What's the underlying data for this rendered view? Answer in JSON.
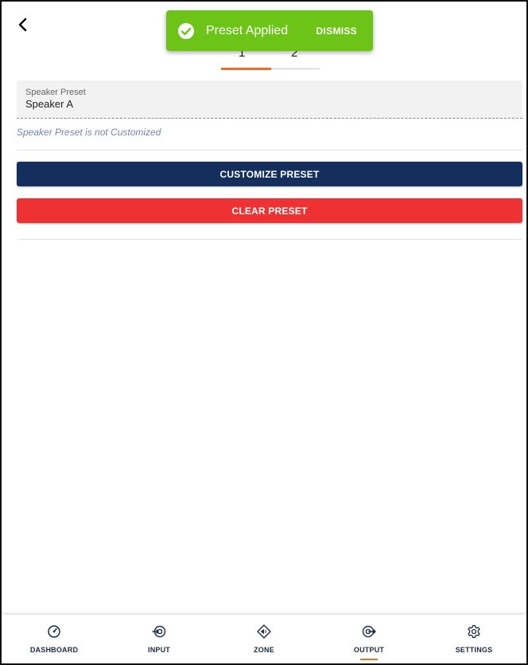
{
  "header": {
    "back_icon": "chevron-left-icon"
  },
  "tabs": [
    {
      "label": "1"
    },
    {
      "label": "2"
    }
  ],
  "active_tab_index": 0,
  "toast": {
    "icon": "check-circle-icon",
    "message": "Preset Applied",
    "dismiss_label": "DISMISS",
    "color": "#6cc417"
  },
  "preset_field": {
    "label": "Speaker Preset",
    "value": "Speaker A",
    "helper": "Speaker Preset is not Customized"
  },
  "actions": {
    "customize_label": "CUSTOMIZE PRESET",
    "clear_label": "CLEAR PRESET",
    "customize_color": "#142f5e",
    "clear_color": "#ee3132"
  },
  "bottom_nav": {
    "active": "OUTPUT",
    "accent_color": "#f26b21",
    "items": [
      {
        "label": "DASHBOARD",
        "icon": "gauge-icon"
      },
      {
        "label": "INPUT",
        "icon": "input-icon"
      },
      {
        "label": "ZONE",
        "icon": "zone-speaker-icon"
      },
      {
        "label": "OUTPUT",
        "icon": "output-icon"
      },
      {
        "label": "SETTINGS",
        "icon": "gear-icon"
      }
    ]
  }
}
